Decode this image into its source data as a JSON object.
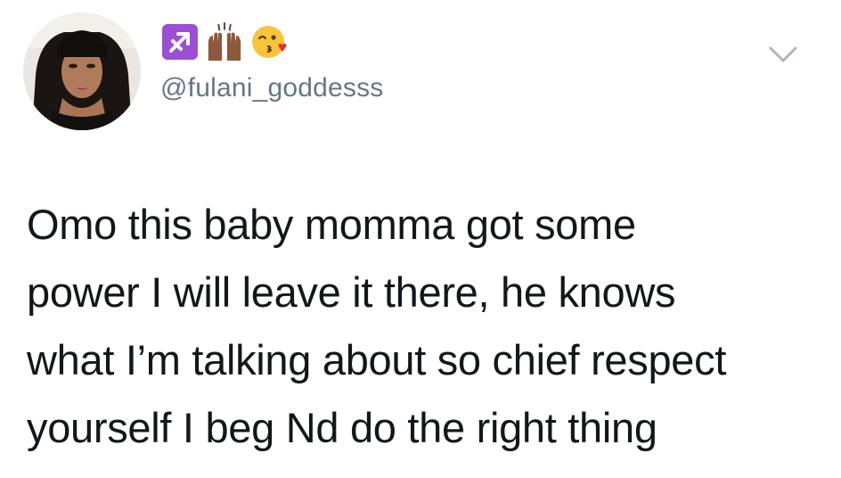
{
  "tweet": {
    "author": {
      "display_name_emojis": [
        "sagittarius-emoji",
        "raised-hands-emoji",
        "kissing-heart-emoji"
      ],
      "handle": "@fulani_goddesss"
    },
    "text_lines": [
      "Omo this baby momma got some",
      "power I will leave it there, he knows",
      "what I’m talking about so chief respect",
      "yourself I beg Nd do the right thing"
    ],
    "menu_icon": "chevron-down-icon"
  },
  "colors": {
    "text": "#14171a",
    "secondary_text": "#657786",
    "chevron": "#aab8c2",
    "sagittarius_bg": "#9b4fd4"
  }
}
